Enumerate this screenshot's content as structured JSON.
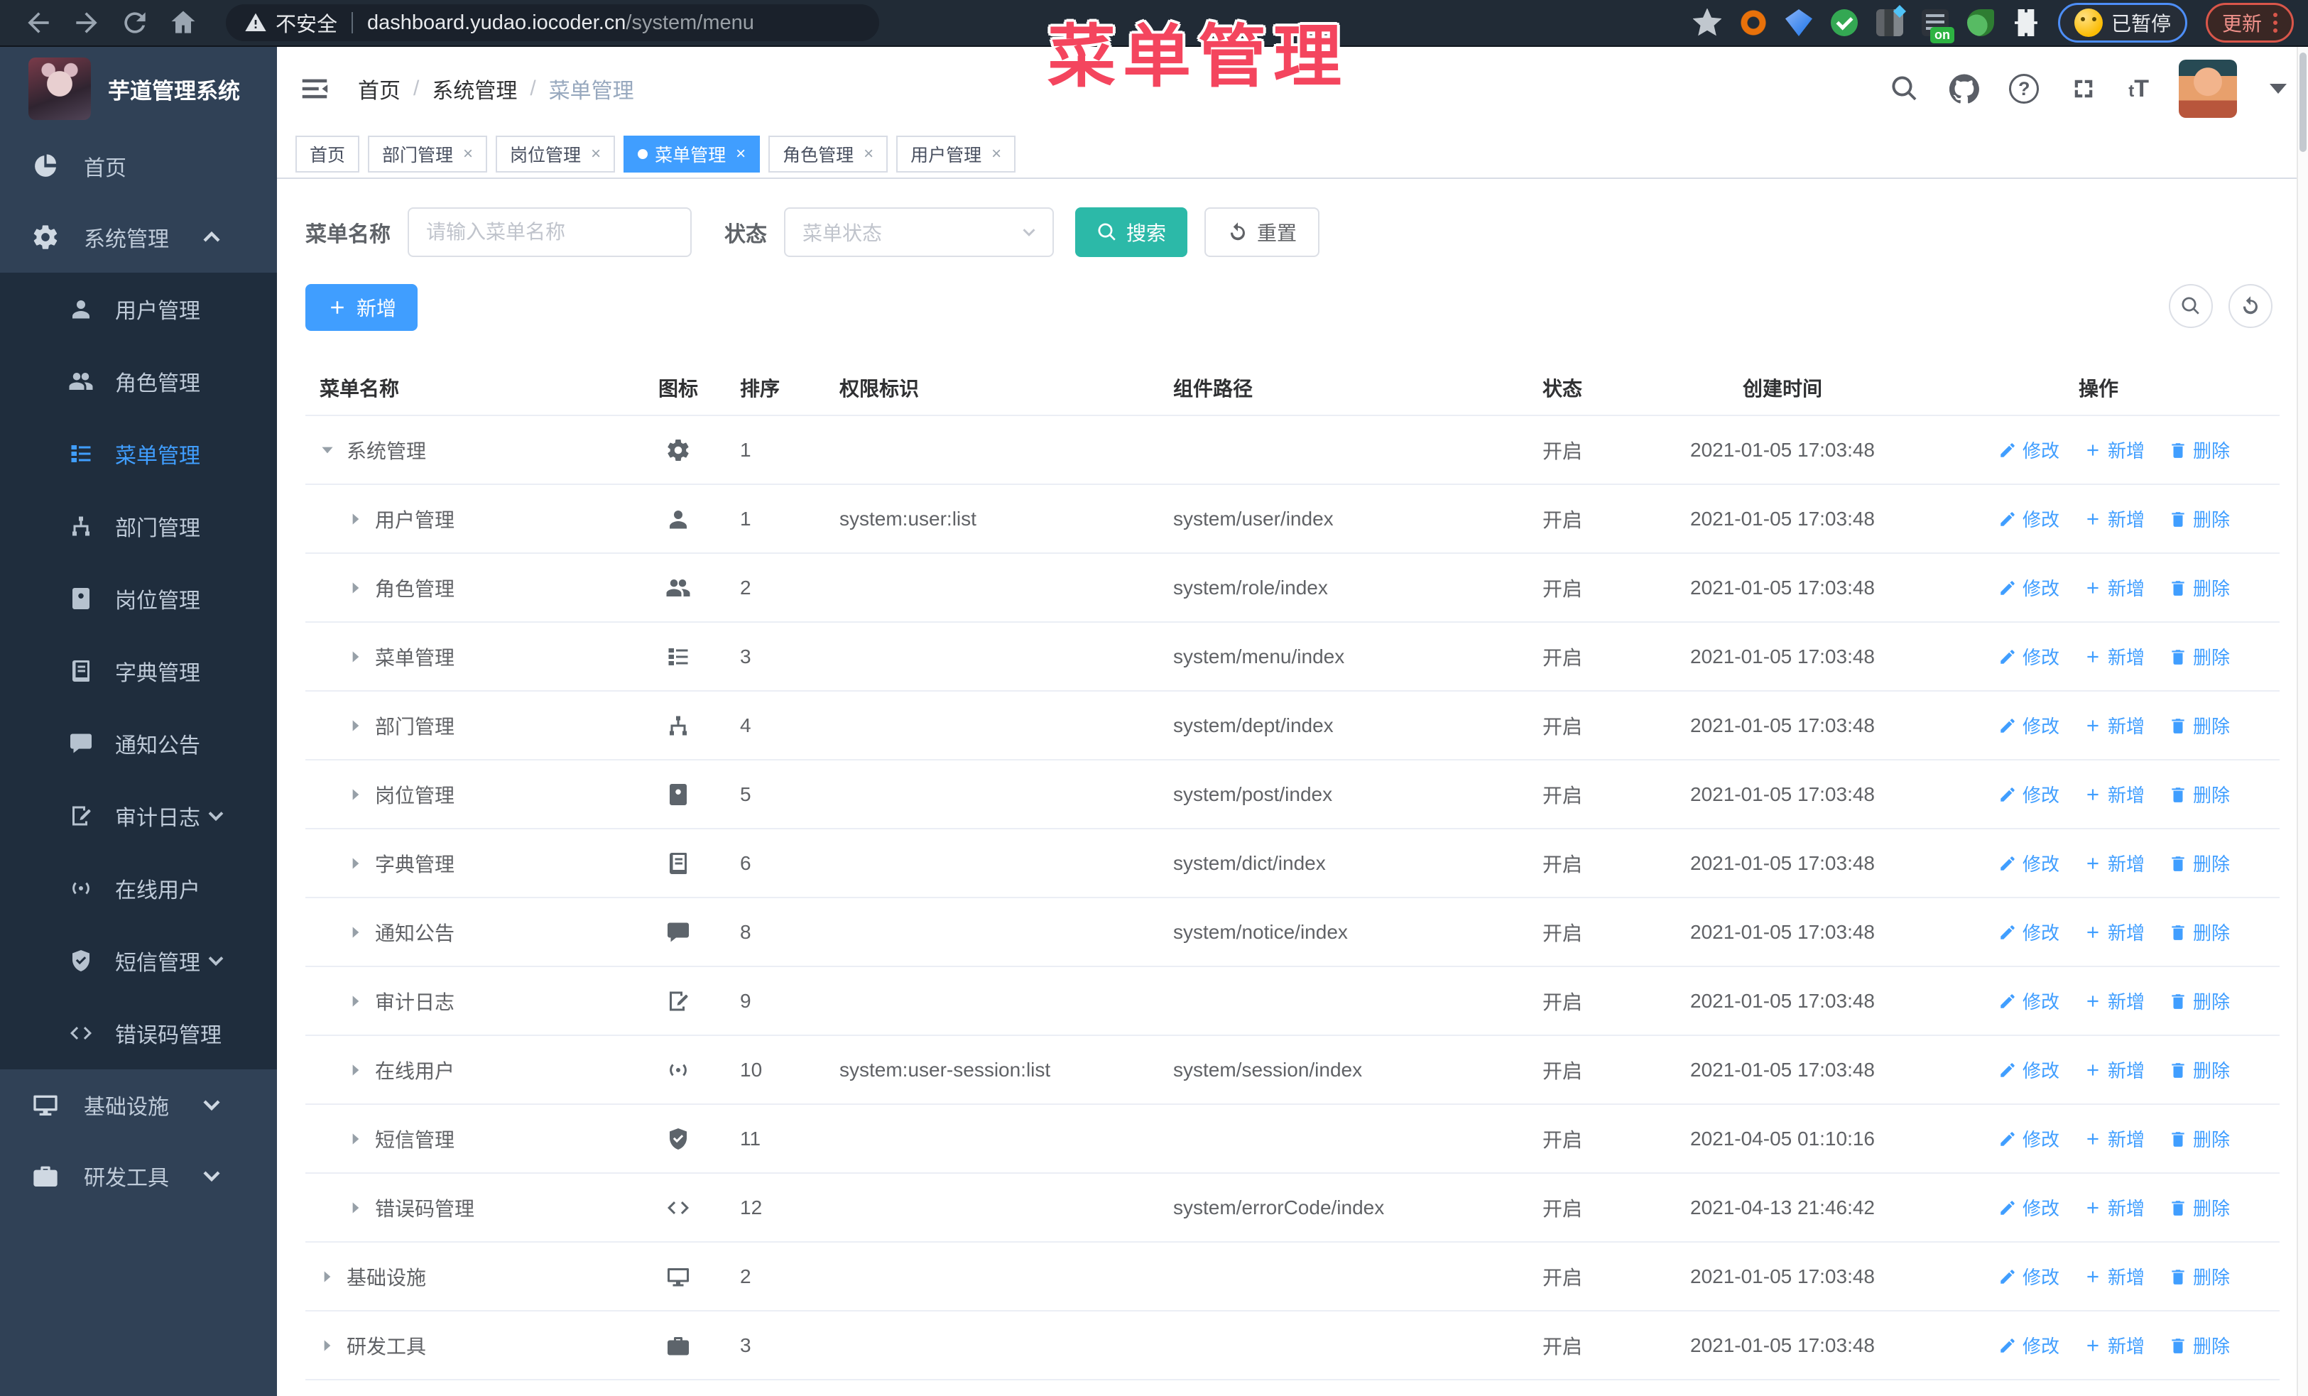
{
  "colors": {
    "accent": "#409eff",
    "teal": "#2cb9a8",
    "sidebar_bg": "#304156",
    "submenu_bg": "#1f2d3d",
    "overlay_pink": "#f4455e",
    "active_tag": "#409eff"
  },
  "browser": {
    "security_label": "不安全",
    "url_host": "dashboard.yudao.iocoder.cn",
    "url_path": "/system/menu",
    "paused_label": "已暂停",
    "update_label": "更新",
    "extension_on_badge": "on"
  },
  "overlay_title": "菜单管理",
  "sidebar": {
    "app_title": "芋道管理系统",
    "items": [
      {
        "label": "首页",
        "icon": "home-icon"
      },
      {
        "label": "系统管理",
        "icon": "gear-icon",
        "expanded": true,
        "arrow": "up",
        "children": [
          {
            "label": "用户管理",
            "icon": "user-icon"
          },
          {
            "label": "角色管理",
            "icon": "users-icon"
          },
          {
            "label": "菜单管理",
            "icon": "menu-icon",
            "active": true
          },
          {
            "label": "部门管理",
            "icon": "dept-icon"
          },
          {
            "label": "岗位管理",
            "icon": "post-icon"
          },
          {
            "label": "字典管理",
            "icon": "dict-icon"
          },
          {
            "label": "通知公告",
            "icon": "notice-icon"
          },
          {
            "label": "审计日志",
            "icon": "log-icon",
            "arrow": "down"
          },
          {
            "label": "在线用户",
            "icon": "online-icon"
          },
          {
            "label": "短信管理",
            "icon": "sms-icon",
            "arrow": "down"
          },
          {
            "label": "错误码管理",
            "icon": "code-icon"
          }
        ]
      },
      {
        "label": "基础设施",
        "icon": "monitor-icon",
        "arrow": "down"
      },
      {
        "label": "研发工具",
        "icon": "tool-icon",
        "arrow": "down"
      }
    ]
  },
  "navbar": {
    "breadcrumb": [
      "首页",
      "系统管理",
      "菜单管理"
    ]
  },
  "tags": [
    {
      "label": "首页",
      "closable": false,
      "active": false
    },
    {
      "label": "部门管理",
      "closable": true,
      "active": false
    },
    {
      "label": "岗位管理",
      "closable": true,
      "active": false
    },
    {
      "label": "菜单管理",
      "closable": true,
      "active": true
    },
    {
      "label": "角色管理",
      "closable": true,
      "active": false
    },
    {
      "label": "用户管理",
      "closable": true,
      "active": false
    }
  ],
  "filters": {
    "name_label": "菜单名称",
    "name_placeholder": "请输入菜单名称",
    "status_label": "状态",
    "status_placeholder": "菜单状态",
    "search_label": "搜索",
    "reset_label": "重置"
  },
  "toolbar": {
    "add_label": "新增"
  },
  "table": {
    "columns": [
      "菜单名称",
      "图标",
      "排序",
      "权限标识",
      "组件路径",
      "状态",
      "创建时间",
      "操作"
    ],
    "row_actions": [
      {
        "label": "修改",
        "icon": "edit-icon"
      },
      {
        "label": "新增",
        "icon": "plus-icon"
      },
      {
        "label": "删除",
        "icon": "delete-icon"
      }
    ],
    "rows": [
      {
        "name": "系统管理",
        "level": 0,
        "expanded": true,
        "icon": "gear-icon",
        "sort": "1",
        "perm": "",
        "path": "",
        "status": "开启",
        "created": "2021-01-05 17:03:48"
      },
      {
        "name": "用户管理",
        "level": 1,
        "icon": "user-icon",
        "sort": "1",
        "perm": "system:user:list",
        "path": "system/user/index",
        "status": "开启",
        "created": "2021-01-05 17:03:48"
      },
      {
        "name": "角色管理",
        "level": 1,
        "icon": "users-icon",
        "sort": "2",
        "perm": "",
        "path": "system/role/index",
        "status": "开启",
        "created": "2021-01-05 17:03:48"
      },
      {
        "name": "菜单管理",
        "level": 1,
        "icon": "menu-icon",
        "sort": "3",
        "perm": "",
        "path": "system/menu/index",
        "status": "开启",
        "created": "2021-01-05 17:03:48"
      },
      {
        "name": "部门管理",
        "level": 1,
        "icon": "dept-icon",
        "sort": "4",
        "perm": "",
        "path": "system/dept/index",
        "status": "开启",
        "created": "2021-01-05 17:03:48"
      },
      {
        "name": "岗位管理",
        "level": 1,
        "icon": "post-icon",
        "sort": "5",
        "perm": "",
        "path": "system/post/index",
        "status": "开启",
        "created": "2021-01-05 17:03:48"
      },
      {
        "name": "字典管理",
        "level": 1,
        "icon": "dict-icon",
        "sort": "6",
        "perm": "",
        "path": "system/dict/index",
        "status": "开启",
        "created": "2021-01-05 17:03:48"
      },
      {
        "name": "通知公告",
        "level": 1,
        "icon": "notice-icon",
        "sort": "8",
        "perm": "",
        "path": "system/notice/index",
        "status": "开启",
        "created": "2021-01-05 17:03:48"
      },
      {
        "name": "审计日志",
        "level": 1,
        "icon": "log-icon",
        "sort": "9",
        "perm": "",
        "path": "",
        "status": "开启",
        "created": "2021-01-05 17:03:48"
      },
      {
        "name": "在线用户",
        "level": 1,
        "icon": "online-icon",
        "sort": "10",
        "perm": "system:user-session:list",
        "path": "system/session/index",
        "status": "开启",
        "created": "2021-01-05 17:03:48"
      },
      {
        "name": "短信管理",
        "level": 1,
        "icon": "sms-icon",
        "sort": "11",
        "perm": "",
        "path": "",
        "status": "开启",
        "created": "2021-04-05 01:10:16"
      },
      {
        "name": "错误码管理",
        "level": 1,
        "icon": "code-icon",
        "sort": "12",
        "perm": "",
        "path": "system/errorCode/index",
        "status": "开启",
        "created": "2021-04-13 21:46:42"
      },
      {
        "name": "基础设施",
        "level": 0,
        "icon": "monitor-icon",
        "sort": "2",
        "perm": "",
        "path": "",
        "status": "开启",
        "created": "2021-01-05 17:03:48"
      },
      {
        "name": "研发工具",
        "level": 0,
        "icon": "tool-icon",
        "sort": "3",
        "perm": "",
        "path": "",
        "status": "开启",
        "created": "2021-01-05 17:03:48"
      }
    ]
  }
}
